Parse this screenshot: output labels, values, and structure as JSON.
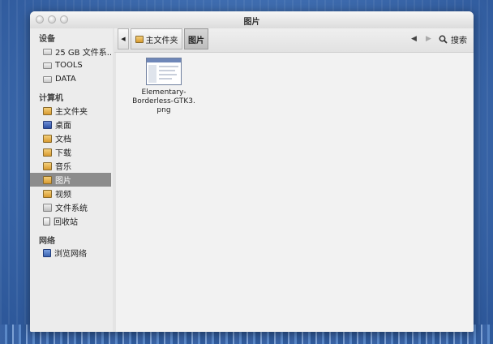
{
  "window": {
    "title": "图片"
  },
  "sidebar": {
    "sections": [
      {
        "heading": "设备",
        "items": [
          {
            "label": "25 GB 文件系...",
            "icon": "drive-icon"
          },
          {
            "label": "TOOLS",
            "icon": "drive-icon"
          },
          {
            "label": "DATA",
            "icon": "drive-icon"
          }
        ]
      },
      {
        "heading": "计算机",
        "items": [
          {
            "label": "主文件夹",
            "icon": "home-folder-icon"
          },
          {
            "label": "桌面",
            "icon": "desktop-icon"
          },
          {
            "label": "文档",
            "icon": "documents-folder-icon"
          },
          {
            "label": "下载",
            "icon": "downloads-folder-icon"
          },
          {
            "label": "音乐",
            "icon": "music-folder-icon"
          },
          {
            "label": "图片",
            "icon": "pictures-folder-icon",
            "selected": true
          },
          {
            "label": "视频",
            "icon": "videos-folder-icon"
          },
          {
            "label": "文件系统",
            "icon": "filesystem-icon"
          },
          {
            "label": "回收站",
            "icon": "trash-icon"
          }
        ]
      },
      {
        "heading": "网络",
        "items": [
          {
            "label": "浏览网络",
            "icon": "network-icon"
          }
        ]
      }
    ]
  },
  "toolbar": {
    "path": [
      "主文件夹",
      "图片"
    ],
    "search_label": "搜索"
  },
  "files": [
    {
      "name": "Elementary-Borderless-GTK3.png",
      "name_lines": [
        "Elementary-",
        "Borderless-GTK3.",
        "png"
      ]
    }
  ]
}
